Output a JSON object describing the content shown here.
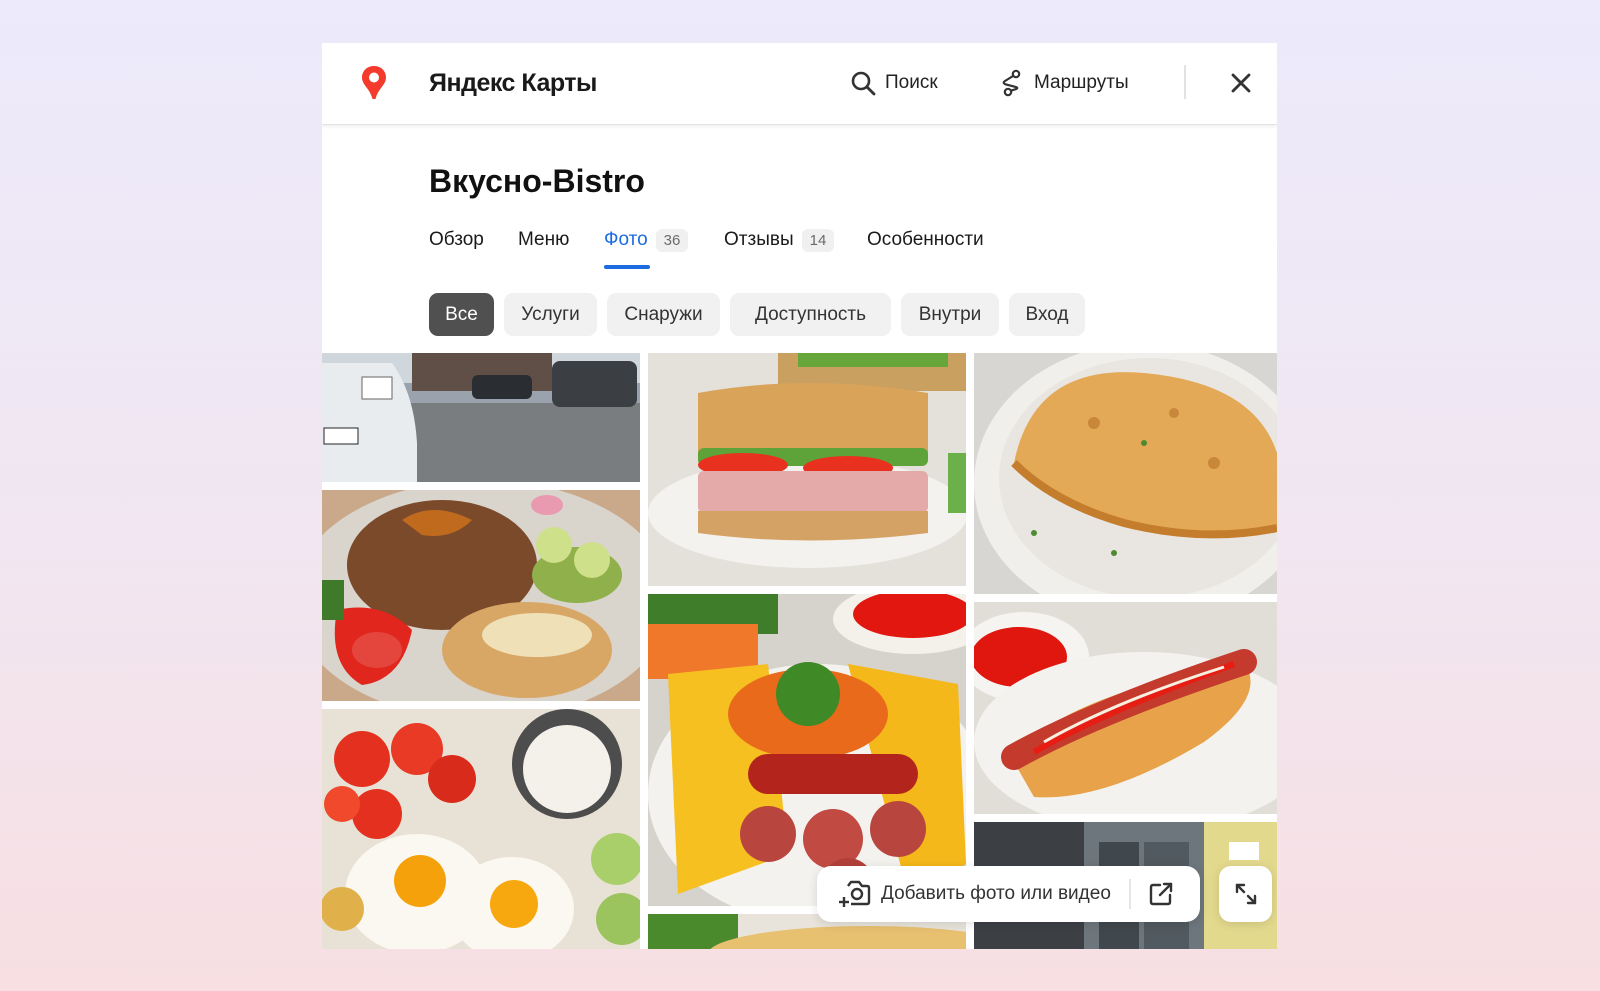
{
  "header": {
    "brand": "Яндекс Карты",
    "search_label": "Поиск",
    "routes_label": "Маршруты",
    "icons": {
      "logo": "map-pin-icon",
      "search": "search-icon",
      "routes": "route-icon",
      "close": "close-icon"
    },
    "colors": {
      "pin": "#f33a2c"
    }
  },
  "place": {
    "title": "Вкусно-Bistro"
  },
  "tabs": [
    {
      "label": "Обзор",
      "count": null,
      "active": false
    },
    {
      "label": "Меню",
      "count": null,
      "active": false
    },
    {
      "label": "Фото",
      "count": "36",
      "active": true
    },
    {
      "label": "Отзывы",
      "count": "14",
      "active": false
    },
    {
      "label": "Особенности",
      "count": null,
      "active": false
    }
  ],
  "filters": [
    {
      "label": "Все",
      "active": true
    },
    {
      "label": "Услуги",
      "active": false
    },
    {
      "label": "Снаружи",
      "active": false
    },
    {
      "label": "Доступность",
      "active": false
    },
    {
      "label": "Внутри",
      "active": false
    },
    {
      "label": "Вход",
      "active": false
    }
  ],
  "photos": [
    "street-parking-photo",
    "buckwheat-chicken-plate-photo",
    "fried-eggs-vegetables-photo",
    "ham-sandwich-photo",
    "fries-sausages-photo",
    "soup-photo",
    "chebureki-pastry-photo",
    "hot-dog-photo",
    "entrance-photo"
  ],
  "actions": {
    "add_photo_label": "Добавить фото или видео",
    "icons": {
      "add_photo": "camera-plus-icon",
      "share": "external-link-icon",
      "expand": "expand-icon"
    }
  },
  "colors": {
    "accent": "#1c6ce0",
    "active_chip": "#505050"
  }
}
